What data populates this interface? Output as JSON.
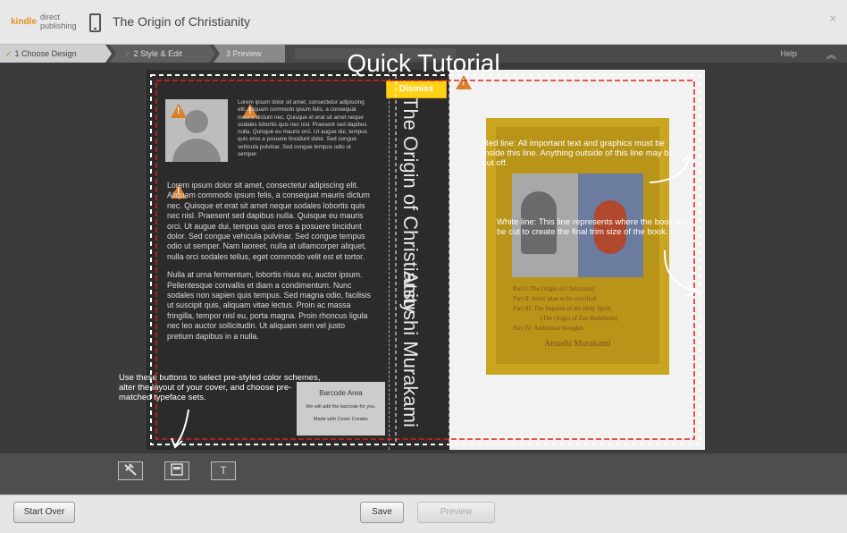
{
  "header": {
    "logo_kindle": "kindle",
    "logo_direct": "direct",
    "logo_publishing": "publishing",
    "book_title": "The Origin of Christianity",
    "close_label": "×"
  },
  "steps": [
    {
      "label": "1 Choose Design",
      "done": true
    },
    {
      "label": "2 Style & Edit",
      "done": true
    },
    {
      "label": "3 Preview",
      "done": false
    }
  ],
  "stepsbar": {
    "help_label": "Help",
    "collapse_icon": "chevron-up-icon"
  },
  "tutorial": {
    "title": "Quick Tutorial",
    "dismiss_label": "Dismiss",
    "red_line_note": "Red line: All important text and graphics must be inside this line. Anything outside of this line may be cut off.",
    "white_line_note": "White line: This line represents where the book will be cut to create the final trim size of the book.",
    "buttons_note": "Use these buttons to select pre-styled color schemes, alter the layout of your cover, and choose pre-matched typeface sets."
  },
  "cover": {
    "back": {
      "bio": "Lorem ipsum dolor sit amet, consectetur adipiscing elit. Aliquam commodo ipsum felis, a consequat mauris dictum nec. Quisque et erat sit amet neque sodales lobortis quis nec nisl. Praesent sed dapibus nulla. Quisque eu mauris orci. Ut augue dui, tempus quis eros a posuere tincidunt dolor. Sed congue vehicula pulvinar. Sed congue tempus odio ut semper.",
      "para1": "Lorem ipsum dolor sit amet, consectetur adipiscing elit. Aliquam commodo ipsum felis, a consequat mauris dictum nec. Quisque et erat sit amet neque sodales lobortis quis nec nisl. Praesent sed dapibus nulla. Quisque eu mauris orci. Ut augue dui, tempus quis eros a posuere tincidunt dolor. Sed congue vehicula pulvinar. Sed congue tempus odio ut semper. Nam laoreet, nulla at ullamcorper aliquet, nulla orci sodales tellus, eget commodo velit est et tortor.",
      "para2": "Nulla at urna fermentum, lobortis risus eu, auctor ipsum. Pellentesque convallis et diam a condimentum. Nunc sodales non sapien quis tempus. Sed magna odio, facilisis ut suscipit quis, aliquam vitae lectus. Proin ac massa fringilla, tempor nisl eu, porta magna. Proin rhoncus ligula nec leo auctor sollicitudin. Ut aliquam sem vel justo pretium dapibus in a nulla.",
      "barcode_title": "Barcode Area",
      "barcode_line1": "We will add the barcode for you.",
      "barcode_line2": "Made with Cover Creator"
    },
    "spine": {
      "title": "The Origin of Christianity",
      "author": "Atsushi Murakami"
    },
    "front": {
      "parts": [
        "Part I: The Origin of Christianity",
        "Part II: Jesus' plan to be crucified",
        "Part III: The Impetus of the Holy Spirit",
        "(The Origin of Zen Buddhism)",
        "Part IV: Additional thoughts"
      ],
      "author": "Atsushi Murakami"
    }
  },
  "toolbar": {
    "buttons": [
      {
        "icon": "color-scheme-icon"
      },
      {
        "icon": "layout-icon"
      },
      {
        "icon": "typeface-icon"
      }
    ]
  },
  "footer": {
    "start_over": "Start Over",
    "save": "Save",
    "preview": "Preview"
  }
}
